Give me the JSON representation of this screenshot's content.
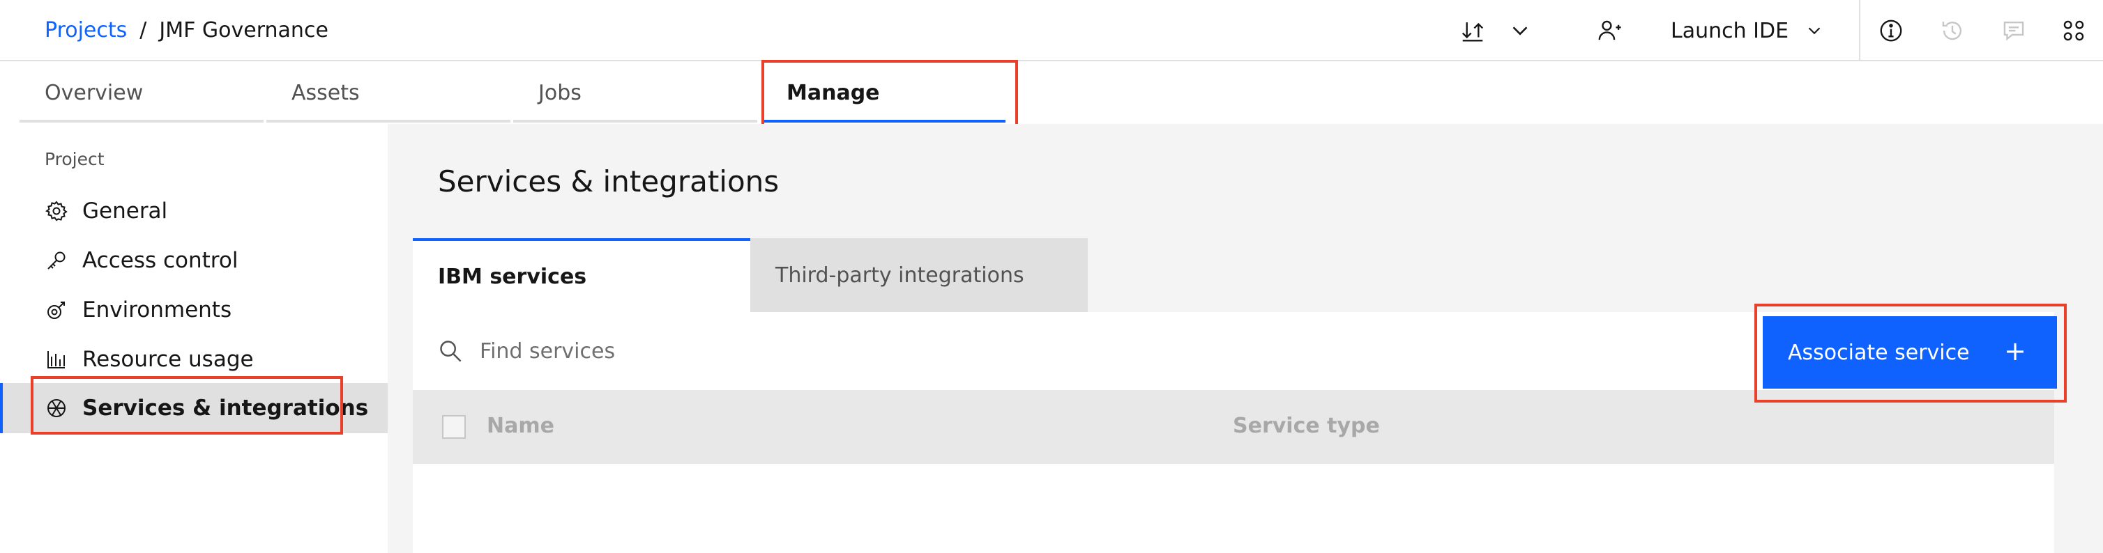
{
  "breadcrumb": {
    "projects_link": "Projects",
    "separator": "/",
    "current": "JMF Governance"
  },
  "header": {
    "launch_label": "Launch IDE",
    "icons": [
      "import-export-icon",
      "chevron-down-icon",
      "add-user-icon",
      "chevron-down-icon",
      "information-icon",
      "history-icon",
      "comments-icon",
      "apps-icon"
    ]
  },
  "tabs": [
    {
      "label": "Overview",
      "active": false
    },
    {
      "label": "Assets",
      "active": false
    },
    {
      "label": "Jobs",
      "active": false
    },
    {
      "label": "Manage",
      "active": true
    }
  ],
  "sidebar": {
    "heading": "Project",
    "items": [
      {
        "label": "General",
        "icon": "gear-icon"
      },
      {
        "label": "Access control",
        "icon": "key-icon"
      },
      {
        "label": "Environments",
        "icon": "environment-icon"
      },
      {
        "label": "Resource usage",
        "icon": "bar-chart-icon"
      },
      {
        "label": "Services & integrations",
        "icon": "integration-icon",
        "active": true
      }
    ]
  },
  "main": {
    "title": "Services & integrations",
    "subtabs": [
      {
        "label": "IBM services",
        "active": true
      },
      {
        "label": "Third-party integrations",
        "active": false
      }
    ],
    "search": {
      "placeholder": "Find services",
      "value": ""
    },
    "associate_button": {
      "label": "Associate service",
      "icon": "+"
    },
    "table": {
      "columns": [
        "Name",
        "Service type"
      ],
      "rows": []
    }
  },
  "colors": {
    "accent": "#0f62fe",
    "highlight": "#e8402a",
    "background": "#f4f4f4"
  }
}
